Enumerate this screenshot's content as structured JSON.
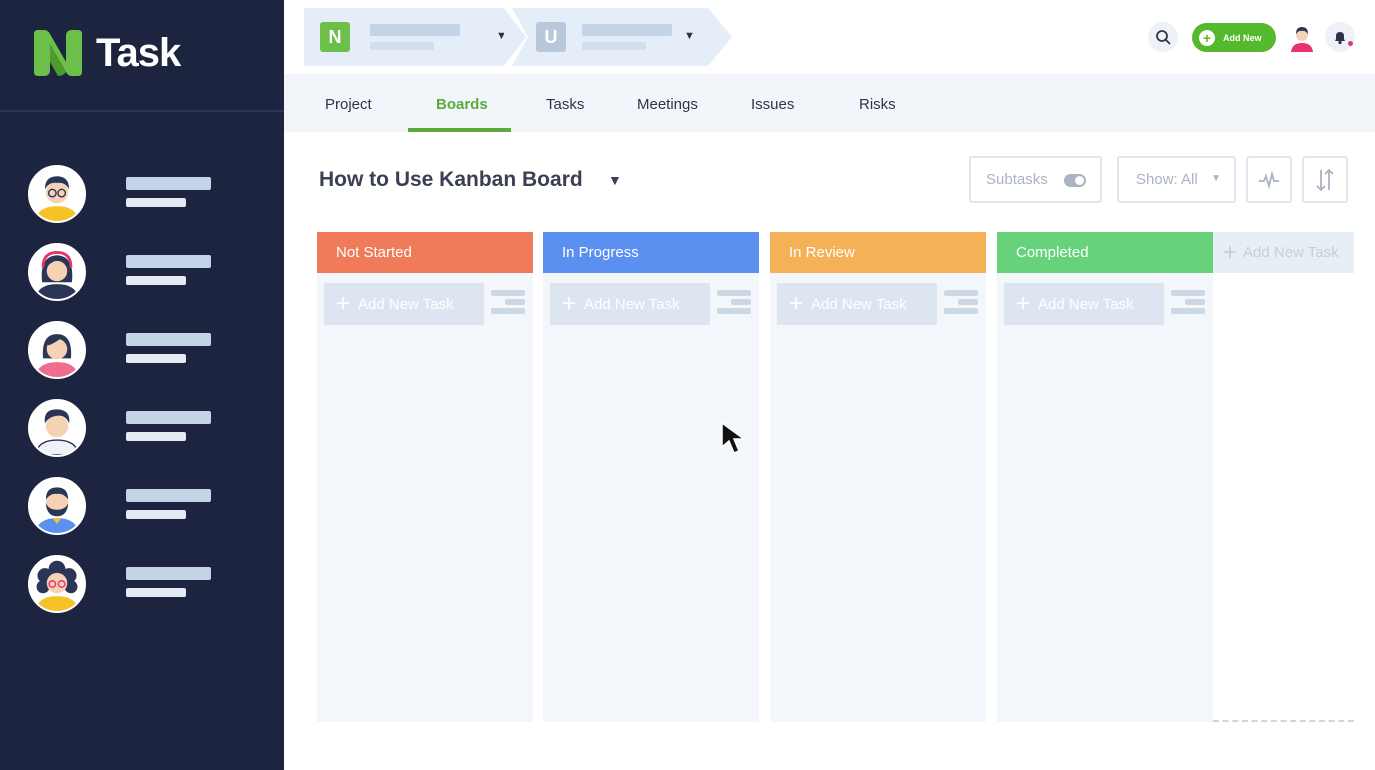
{
  "app": {
    "name": "Task",
    "colors": {
      "sidebar": "#1c2440",
      "brand_green": "#6cc04a",
      "accent_green": "#5aab3a"
    }
  },
  "sidebar": {
    "members": [
      {
        "avatar": "avatar-man-glasses-yellow"
      },
      {
        "avatar": "avatar-woman-headphones"
      },
      {
        "avatar": "avatar-woman-pink"
      },
      {
        "avatar": "avatar-man-white"
      },
      {
        "avatar": "avatar-man-beard-yellow"
      },
      {
        "avatar": "avatar-woman-curly-glasses"
      }
    ]
  },
  "topbar": {
    "crumb1_badge": "N",
    "crumb2_badge": "U",
    "add_new_label": "Add New",
    "icons": [
      "search-icon",
      "user-avatar",
      "bell-icon"
    ]
  },
  "tabs": [
    {
      "label": "Project",
      "active": false
    },
    {
      "label": "Boards",
      "active": true
    },
    {
      "label": "Tasks",
      "active": false
    },
    {
      "label": "Meetings",
      "active": false
    },
    {
      "label": "Issues",
      "active": false
    },
    {
      "label": "Risks",
      "active": false
    }
  ],
  "board": {
    "title": "How to Use Kanban Board",
    "subtasks_label": "Subtasks",
    "show_label": "Show: All",
    "columns": [
      {
        "label": "Not Started",
        "color": "#f07b5a",
        "add_label": "Add New Task"
      },
      {
        "label": "In Progress",
        "color": "#5b8ff0",
        "add_label": "Add New Task"
      },
      {
        "label": "In Review",
        "color": "#f5b157",
        "add_label": "Add New Task"
      },
      {
        "label": "Completed",
        "color": "#66d27c",
        "add_label": "Add New Task"
      }
    ],
    "add_column_label": "Add New Task"
  }
}
